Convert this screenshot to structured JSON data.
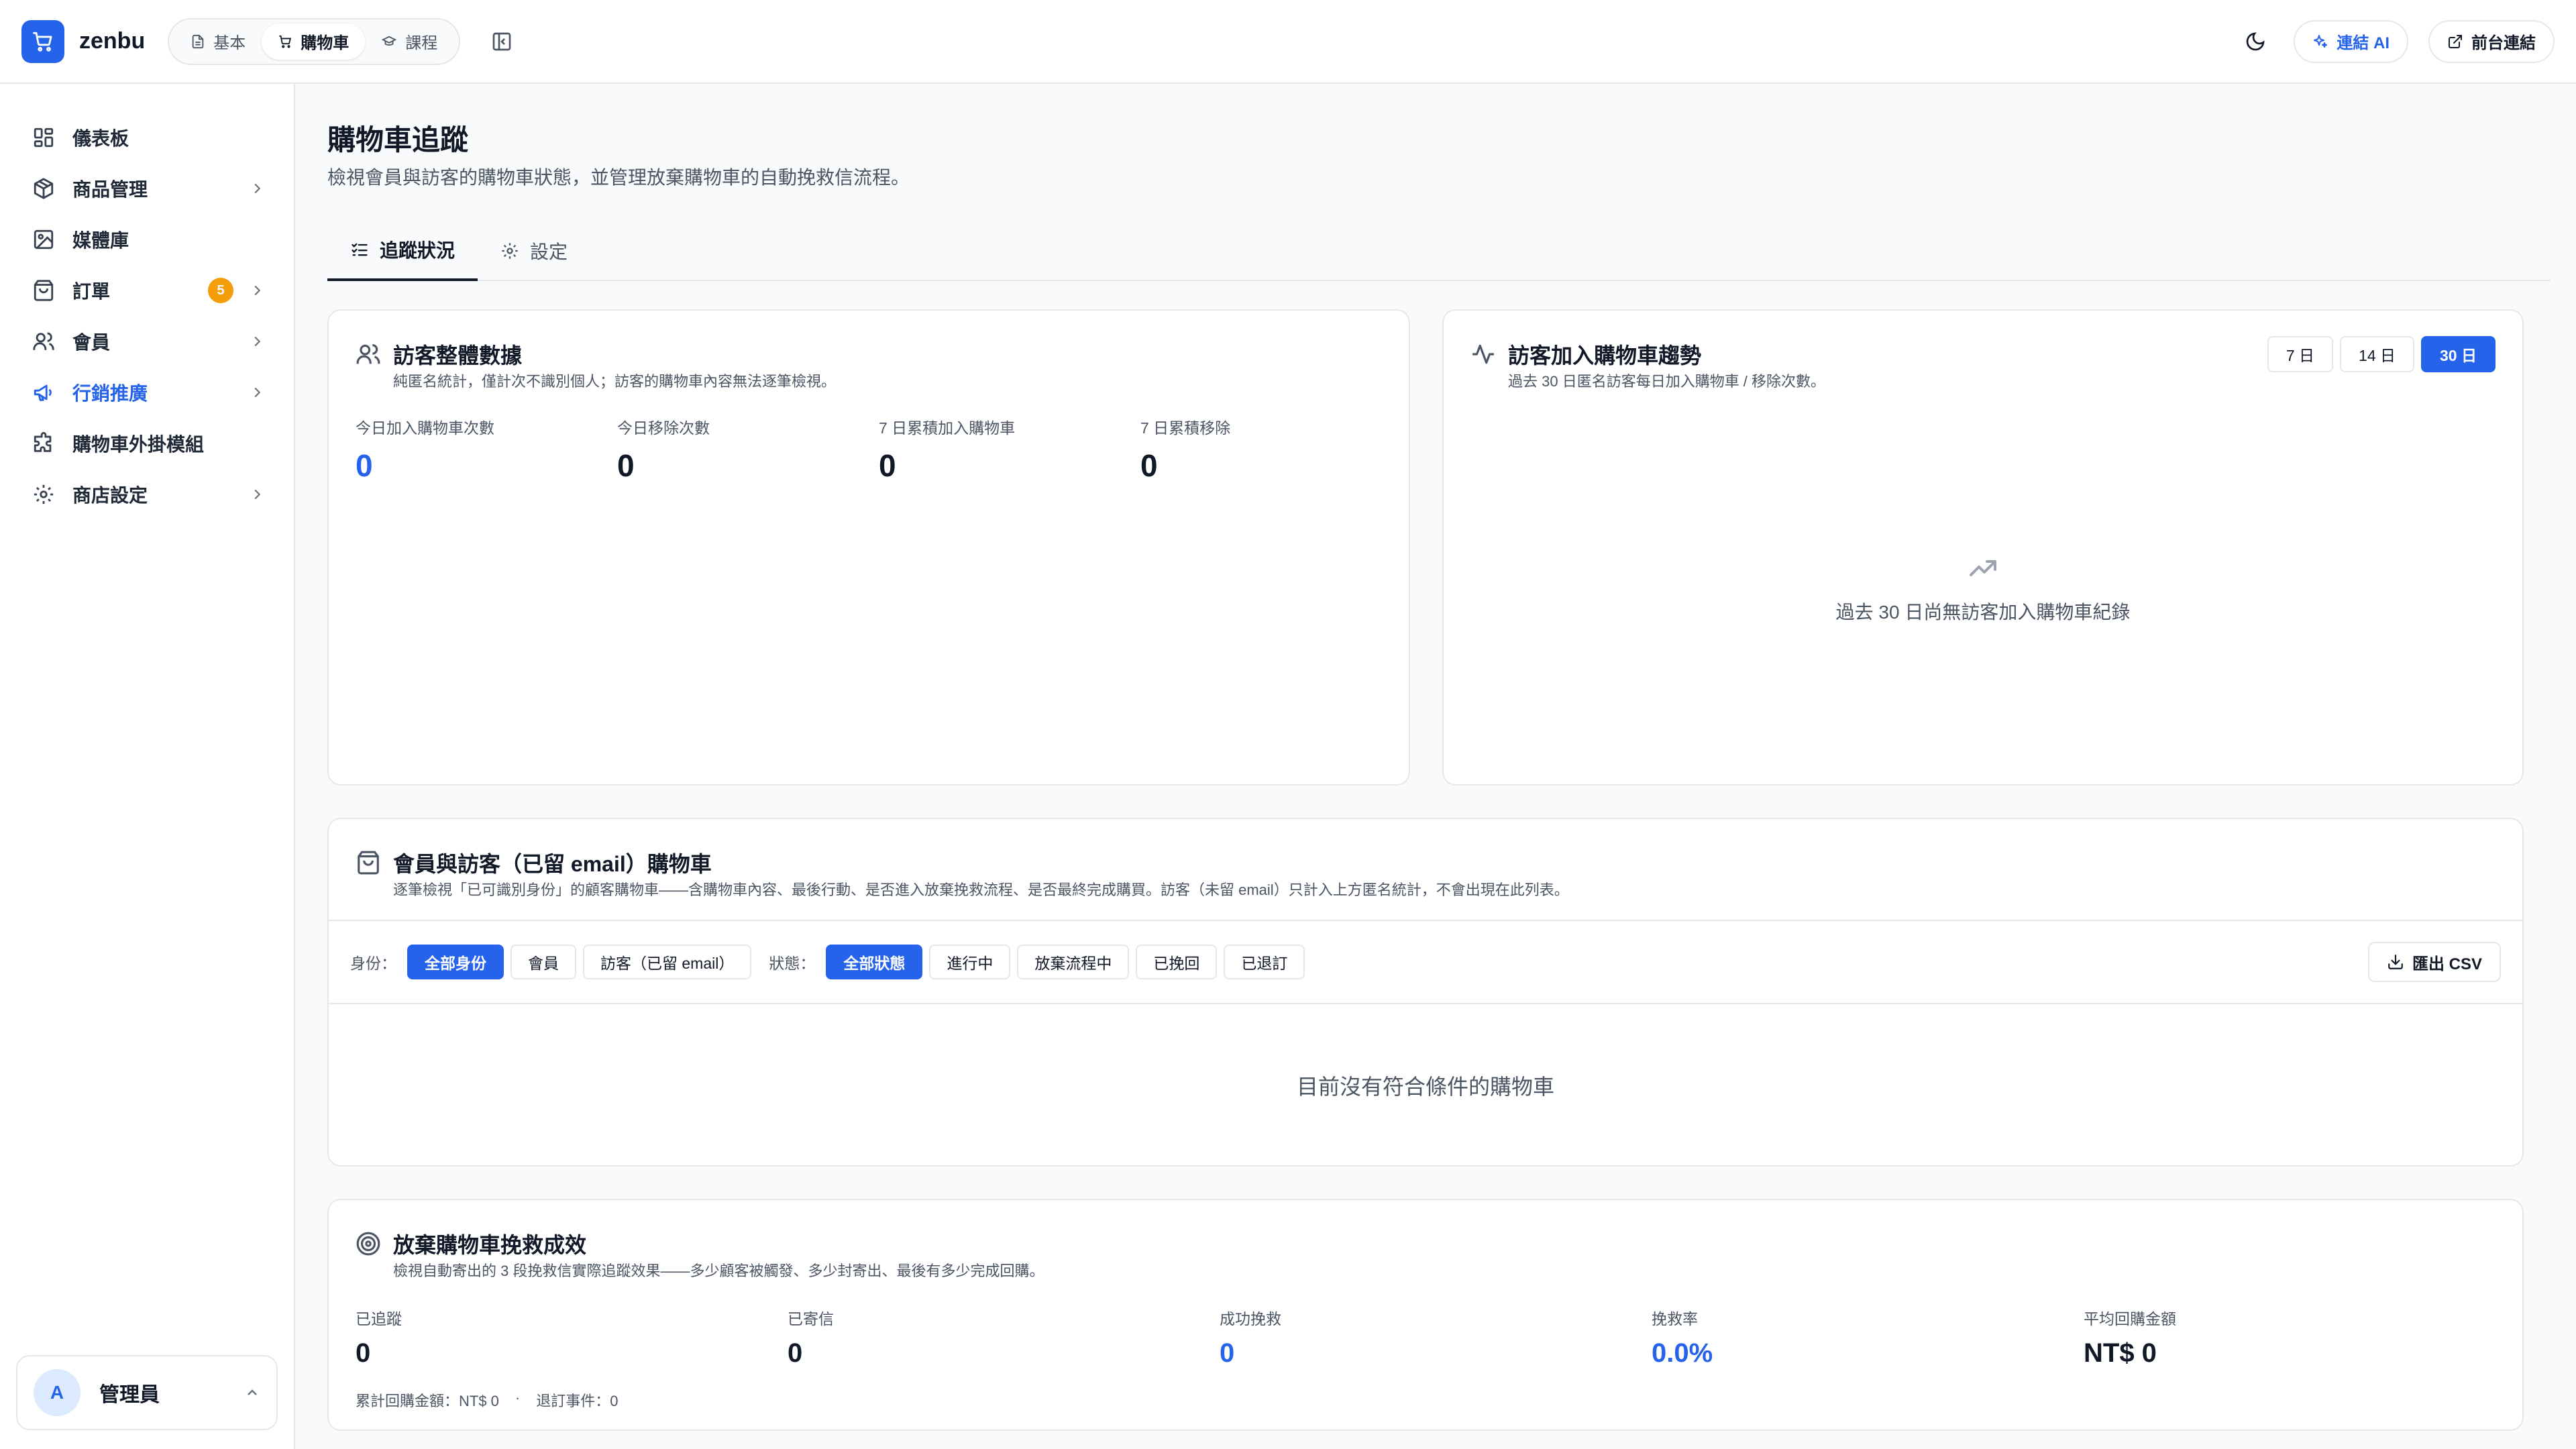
{
  "app": {
    "name": "zenbu"
  },
  "top_tabs": [
    {
      "label": "基本"
    },
    {
      "label": "購物車"
    },
    {
      "label": "課程"
    }
  ],
  "top_right": {
    "ai_label": "連結 AI",
    "storefront_label": "前台連結"
  },
  "sidebar": {
    "items": [
      {
        "label": "儀表板"
      },
      {
        "label": "商品管理"
      },
      {
        "label": "媒體庫"
      },
      {
        "label": "訂單",
        "badge": "5"
      },
      {
        "label": "會員"
      },
      {
        "label": "行銷推廣"
      },
      {
        "label": "購物車外掛模組"
      },
      {
        "label": "商店設定"
      }
    ],
    "user": {
      "initial": "A",
      "name": "管理員"
    }
  },
  "page": {
    "title": "購物車追蹤",
    "description": "檢視會員與訪客的購物車狀態，並管理放棄購物車的自動挽救信流程。",
    "tabs": [
      {
        "label": "追蹤狀況"
      },
      {
        "label": "設定"
      }
    ]
  },
  "visitor_stats": {
    "title": "訪客整體數據",
    "subtitle": "純匿名統計，僅計次不識別個人；訪客的購物車內容無法逐筆檢視。",
    "stats": [
      {
        "label": "今日加入購物車次數",
        "value": "0"
      },
      {
        "label": "今日移除次數",
        "value": "0"
      },
      {
        "label": "7 日累積加入購物車",
        "value": "0"
      },
      {
        "label": "7 日累積移除",
        "value": "0"
      }
    ]
  },
  "trend": {
    "title": "訪客加入購物車趨勢",
    "subtitle": "過去 30 日匿名訪客每日加入購物車 / 移除次數。",
    "ranges": [
      {
        "label": "7 日"
      },
      {
        "label": "14 日"
      },
      {
        "label": "30 日"
      }
    ],
    "active_range": "30 日",
    "empty_text": "過去 30 日尚無訪客加入購物車紀錄"
  },
  "member_carts": {
    "title": "會員與訪客（已留 email）購物車",
    "subtitle": "逐筆檢視「已可識別身份」的顧客購物車——含購物車內容、最後行動、是否進入放棄挽救流程、是否最終完成購買。訪客（未留 email）只計入上方匿名統計，不會出現在此列表。",
    "identity_label": "身份：",
    "identity_options": [
      {
        "label": "全部身份"
      },
      {
        "label": "會員"
      },
      {
        "label": "訪客（已留 email）"
      }
    ],
    "status_label": "狀態：",
    "status_options": [
      {
        "label": "全部狀態"
      },
      {
        "label": "進行中"
      },
      {
        "label": "放棄流程中"
      },
      {
        "label": "已挽回"
      },
      {
        "label": "已退訂"
      }
    ],
    "export_label": "匯出 CSV",
    "empty_text": "目前沒有符合條件的購物車"
  },
  "recovery": {
    "title": "放棄購物車挽救成效",
    "subtitle": "檢視自動寄出的 3 段挽救信實際追蹤效果——多少顧客被觸發、多少封寄出、最後有多少完成回購。",
    "stats": [
      {
        "label": "已追蹤",
        "value": "0"
      },
      {
        "label": "已寄信",
        "value": "0"
      },
      {
        "label": "成功挽救",
        "value": "0"
      },
      {
        "label": "挽救率",
        "value": "0.0%"
      },
      {
        "label": "平均回購金額",
        "value": "NT$ 0"
      }
    ],
    "footer_total": "累計回購金額：NT$ 0",
    "footer_sep": "·",
    "footer_unsub": "退訂事件：0"
  },
  "colors": {
    "accent": "#2563eb",
    "badge": "#f59e0b",
    "border": "#e5e7eb",
    "background": "#f9fafb"
  }
}
